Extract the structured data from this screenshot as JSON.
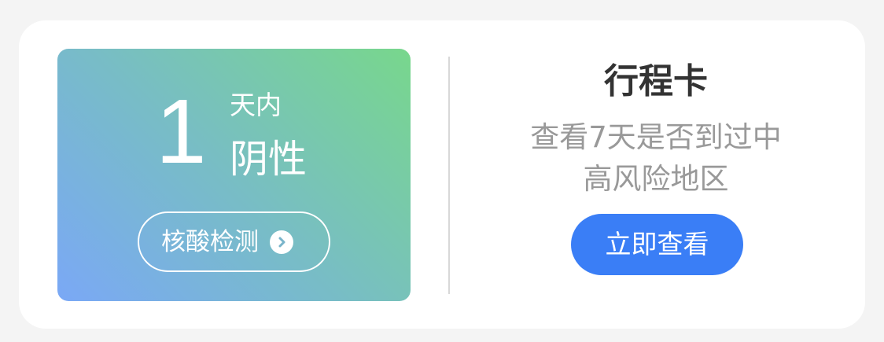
{
  "test_card": {
    "days": "1",
    "days_label": "天内",
    "result": "阴性",
    "button_label": "核酸检测",
    "button_icon": "chevron-right-circle-icon",
    "gradient_colors": [
      "#7aa8f6",
      "#78bdc5",
      "#78d78c"
    ]
  },
  "itinerary_card": {
    "title": "行程卡",
    "description_line1": "查看7天是否到过中",
    "description_line2": "高风险地区",
    "button_label": "立即查看",
    "button_color": "#3a7ef6"
  }
}
